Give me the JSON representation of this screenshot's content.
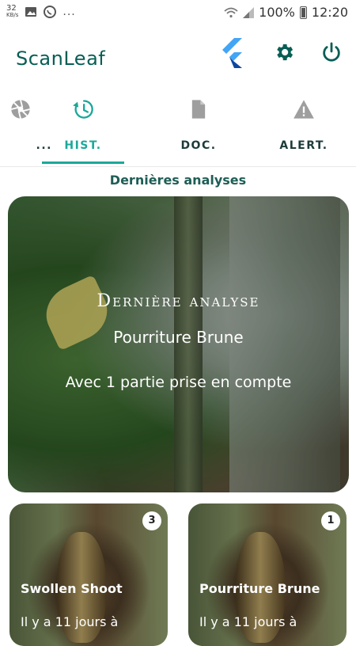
{
  "status_bar": {
    "speed_value": "32",
    "speed_unit": "KB/s",
    "more": "...",
    "battery_percent": "100%",
    "time": "12:20"
  },
  "app_bar": {
    "title": "ScanLeaf",
    "icons": [
      "flutter-icon",
      "gear-icon",
      "power-icon"
    ],
    "accent_color": "#075e54"
  },
  "tabs": [
    {
      "label": "...",
      "icon": "camera-aperture-icon",
      "active": false
    },
    {
      "label": "HIST.",
      "icon": "history-icon",
      "active": true
    },
    {
      "label": "DOC.",
      "icon": "document-icon",
      "active": false
    },
    {
      "label": "ALERT.",
      "icon": "warning-icon",
      "active": false
    }
  ],
  "colors": {
    "active_tab": "#1aa89a",
    "inactive_tab_icon": "#9e9e9e"
  },
  "section_title": "Dernières analyses",
  "hero": {
    "kicker": "Dernière analyse",
    "disease": "Pourriture Brune",
    "subtitle": "Avec 1 partie prise en compte"
  },
  "cards": [
    {
      "title": "Swollen Shoot",
      "count": "3",
      "date": "Il y a 11 jours à"
    },
    {
      "title": "Pourriture Brune",
      "count": "1",
      "date": "Il y a 11 jours à"
    }
  ]
}
